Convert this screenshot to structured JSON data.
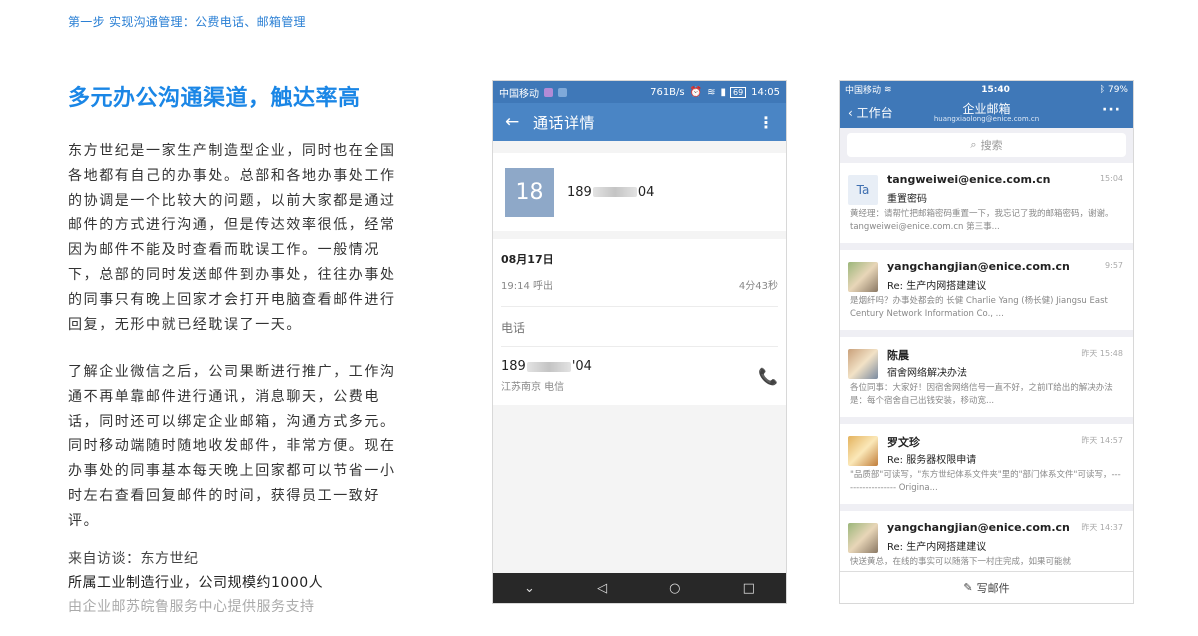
{
  "article": {
    "step": "第一步 实现沟通管理：公费电话、邮箱管理",
    "headline": "多元办公沟通渠道，触达率高",
    "para1": "东方世纪是一家生产制造型企业，同时也在全国各地都有自己的办事处。总部和各地办事处工作的协调是一个比较大的问题，以前大家都是通过邮件的方式进行沟通，但是传达效率很低，经常因为邮件不能及时查看而耽误工作。一般情况下，总部的同时发送邮件到办事处，往往办事处的同事只有晚上回家才会打开电脑查看邮件进行回复，无形中就已经耽误了一天。",
    "para2": "了解企业微信之后，公司果断进行推广，工作沟通不再单靠邮件进行通讯，消息聊天，公费电话，同时还可以绑定企业邮箱，沟通方式多元。同时移动端随时随地收发邮件，非常方便。现在办事处的同事基本每天晚上回家都可以节省一小时左右查看回复邮件的时间，获得员工一致好评。",
    "source1": "来自访谈：东方世纪",
    "source2": "所属工业制造行业，公司规模约1000人",
    "source3": "由企业邮苏皖鲁服务中心提供服务支持"
  },
  "android": {
    "carrier": "中国移动",
    "speed": "761B/s",
    "battery": "69",
    "clock": "14:05",
    "title": "通话详情",
    "avatar_text": "18",
    "num_prefix": "189",
    "num_suffix": "04",
    "date": "08月17日",
    "call_info": "19:14 呼出",
    "duration": "4分43秒",
    "section": "电话",
    "num2_prefix": "189",
    "num2_suffix": "'04",
    "location": "江苏南京 电信"
  },
  "ios": {
    "carrier": "中国移动",
    "clock": "15:40",
    "battery": "79%",
    "back_label": "工作台",
    "title": "企业邮箱",
    "account": "huangxiaolong@enice.com.cn",
    "search_placeholder": "搜索",
    "compose": "写邮件",
    "mails": [
      {
        "avatar": "Ta",
        "from": "tangweiwei@enice.com.cn",
        "time": "15:04",
        "subject": "重置密码",
        "preview": "黄经理：请帮忙把邮箱密码重置一下，我忘记了我的邮箱密码，谢谢。tangweiwei@enice.com.cn 第三事..."
      },
      {
        "avatar": "",
        "from": "yangchangjian@enice.com.cn",
        "time": "9:57",
        "subject": "Re: 生产内网搭建建议",
        "preview": "是烟纤吗？办事处都会的 长健 Charlie Yang (杨长健) Jiangsu East Century Network Information Co., ..."
      },
      {
        "avatar": "",
        "from": "陈晨",
        "time": "昨天 15:48",
        "subject": "宿舍网络解决办法",
        "preview": "各位同事：大家好！因宿舍网络信号一直不好，之前IT给出的解决办法是：每个宿舍自己出钱安装，移动宽..."
      },
      {
        "avatar": "",
        "from": "罗文珍",
        "time": "昨天 14:57",
        "subject": "Re: 服务器权限申请",
        "preview": "\"品质部\"可读写，\"东方世纪体系文件夹\"里的\"部门体系文件\"可读写，------------------ Origina..."
      },
      {
        "avatar": "",
        "from": "yangchangjian@enice.com.cn",
        "time": "昨天 14:37",
        "subject": "Re: 生产内网搭建建议",
        "preview": "快送黄总，在线的事实可以随落下一村庄完成，如果可能就"
      }
    ]
  }
}
